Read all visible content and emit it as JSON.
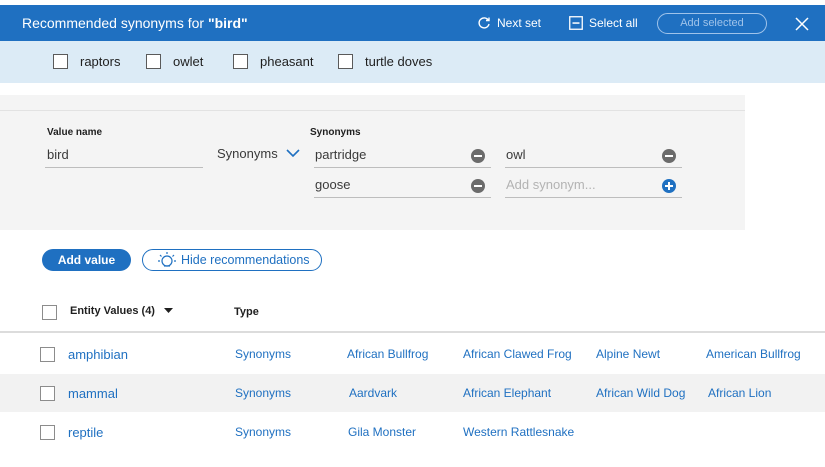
{
  "banner": {
    "title_prefix": "Recommended synonyms for ",
    "title_term": "\"bird\"",
    "next_set": "Next set",
    "select_all": "Select all",
    "add_selected": "Add selected"
  },
  "recommendations": [
    "raptors",
    "owlet",
    "pheasant",
    "turtle doves"
  ],
  "editor": {
    "value_name_label": "Value name",
    "value_name": "bird",
    "type": "Synonyms",
    "synonyms_label": "Synonyms",
    "synonyms": [
      "partridge",
      "owl",
      "goose"
    ],
    "add_synonym_placeholder": "Add synonym..."
  },
  "buttons": {
    "add_value": "Add value",
    "hide_recommendations": "Hide recommendations"
  },
  "table": {
    "col_values": "Entity Values (4)",
    "col_type": "Type",
    "rows": [
      {
        "value": "amphibian",
        "type": "Synonyms",
        "synonyms": [
          "African Bullfrog",
          "African Clawed Frog",
          "Alpine Newt",
          "American Bullfrog"
        ]
      },
      {
        "value": "mammal",
        "type": "Synonyms",
        "synonyms": [
          "Aardvark",
          "African Elephant",
          "African Wild Dog",
          "African Lion"
        ]
      },
      {
        "value": "reptile",
        "type": "Synonyms",
        "synonyms": [
          "Gila Monster",
          "Western Rattlesnake"
        ]
      }
    ]
  },
  "colors": {
    "accent": "#1f70c1",
    "banner_row": "#dcebf6"
  }
}
